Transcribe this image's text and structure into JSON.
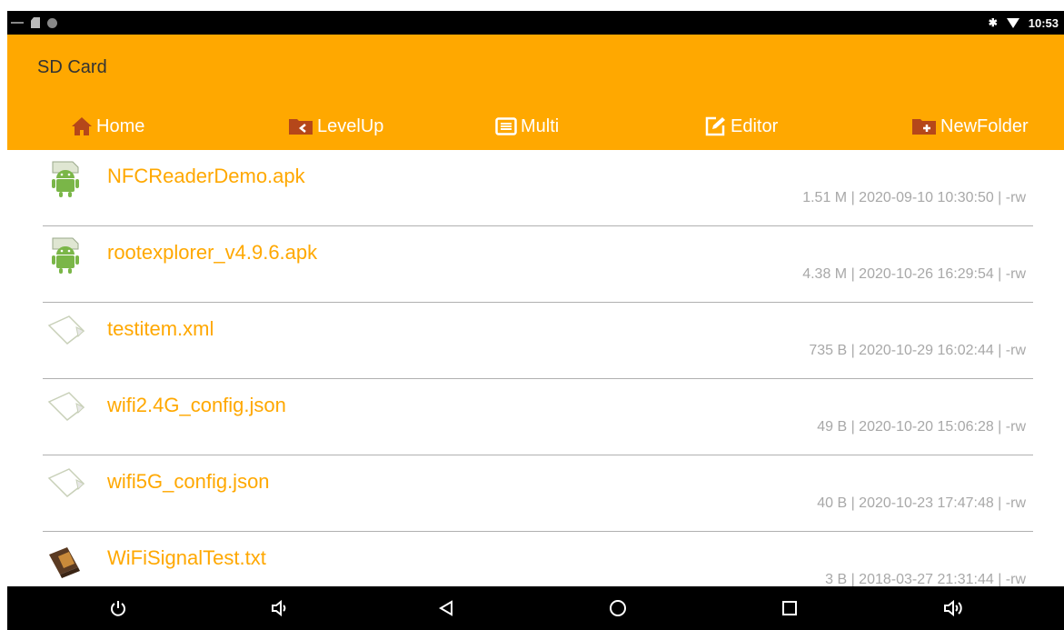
{
  "status_bar": {
    "time": "10:53",
    "icons": [
      "sd-card-icon",
      "bluetooth-icon",
      "wifi-icon"
    ]
  },
  "app": {
    "title": "SD Card",
    "accent_color": "#ffa800"
  },
  "toolbar": [
    {
      "label": "Home",
      "icon": "home-icon"
    },
    {
      "label": "LevelUp",
      "icon": "folder-up-icon"
    },
    {
      "label": "Multi",
      "icon": "list-icon"
    },
    {
      "label": "Editor",
      "icon": "edit-icon"
    },
    {
      "label": "NewFolder",
      "icon": "new-folder-icon"
    }
  ],
  "files": [
    {
      "name": "NFCReaderDemo.apk",
      "meta": "1.51 M | 2020-09-10 10:30:50 | -rw",
      "icon": "android-apk-icon"
    },
    {
      "name": "rootexplorer_v4.9.6.apk",
      "meta": "4.38 M | 2020-10-26 16:29:54 | -rw",
      "icon": "android-apk-icon"
    },
    {
      "name": "testitem.xml",
      "meta": "735 B | 2020-10-29 16:02:44 | -rw",
      "icon": "generic-file-icon"
    },
    {
      "name": "wifi2.4G_config.json",
      "meta": "49 B | 2020-10-20 15:06:28 | -rw",
      "icon": "generic-file-icon"
    },
    {
      "name": "wifi5G_config.json",
      "meta": "40 B | 2020-10-23 17:47:48 | -rw",
      "icon": "generic-file-icon"
    },
    {
      "name": "WiFiSignalTest.txt",
      "meta": "3 B | 2018-03-27 21:31:44 | -rw",
      "icon": "text-file-icon"
    }
  ],
  "nav_bar": [
    "power-icon",
    "volume-down-icon",
    "back-icon",
    "home-circle-icon",
    "recents-icon",
    "volume-up-icon"
  ]
}
